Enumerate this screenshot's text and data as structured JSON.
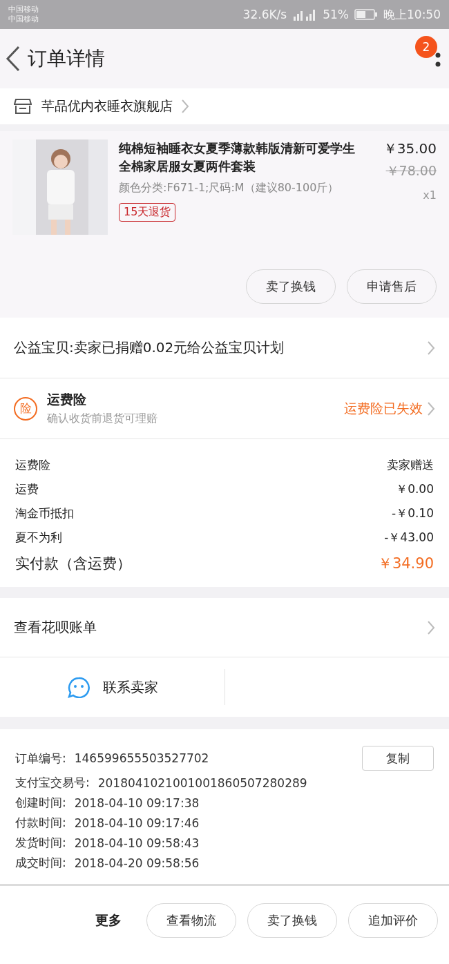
{
  "status_bar": {
    "carriers": [
      "中国移动",
      "中国移动"
    ],
    "speed": "32.6K/s",
    "battery": "51%",
    "time": "晚上10:50"
  },
  "header": {
    "title": "订单详情",
    "badge": "2"
  },
  "shop": {
    "name": "芊品优内衣睡衣旗舰店"
  },
  "product": {
    "title": "纯棉短袖睡衣女夏季薄款韩版清新可爱学生全棉家居服女夏两件套装",
    "price": "￥35.00",
    "original_price": "￥78.00",
    "variant": "颜色分类:F671-1;尺码:M（建议80-100斤）",
    "quantity": "x1",
    "tag": "15天退货",
    "actions": [
      "卖了换钱",
      "申请售后"
    ]
  },
  "charity": {
    "text": "公益宝贝:卖家已捐赠0.02元给公益宝贝计划"
  },
  "insurance": {
    "icon_text": "险",
    "title": "运费险",
    "subtitle": "确认收货前退货可理赔",
    "status": "运费险已失效"
  },
  "costs": [
    {
      "label": "运费险",
      "value": "卖家赠送",
      "kind": "normal"
    },
    {
      "label": "运费",
      "value": "￥0.00",
      "kind": "normal"
    },
    {
      "label": "淘金币抵扣",
      "value": "-￥0.10",
      "kind": "normal"
    },
    {
      "label": "夏不为利",
      "value": "-￥43.00",
      "kind": "normal"
    },
    {
      "label": "实付款（含运费）",
      "value": "￥34.90",
      "kind": "total"
    }
  ],
  "huabei": {
    "label": "查看花呗账单"
  },
  "contact": {
    "label": "联系卖家"
  },
  "order_info": {
    "copy_button": "复制",
    "fields": [
      {
        "label": "订单编号:",
        "value": "146599655503527702"
      },
      {
        "label": "支付宝交易号:",
        "value": "2018041021001001860507280289"
      },
      {
        "label": "创建时间:",
        "value": "2018-04-10 09:17:38"
      },
      {
        "label": "付款时间:",
        "value": "2018-04-10 09:17:46"
      },
      {
        "label": "发货时间:",
        "value": "2018-04-10 09:58:43"
      },
      {
        "label": "成交时间:",
        "value": "2018-04-20 09:58:56"
      }
    ]
  },
  "bottom_bar": {
    "more": "更多",
    "buttons": [
      "查看物流",
      "卖了换钱",
      "追加评价"
    ]
  }
}
